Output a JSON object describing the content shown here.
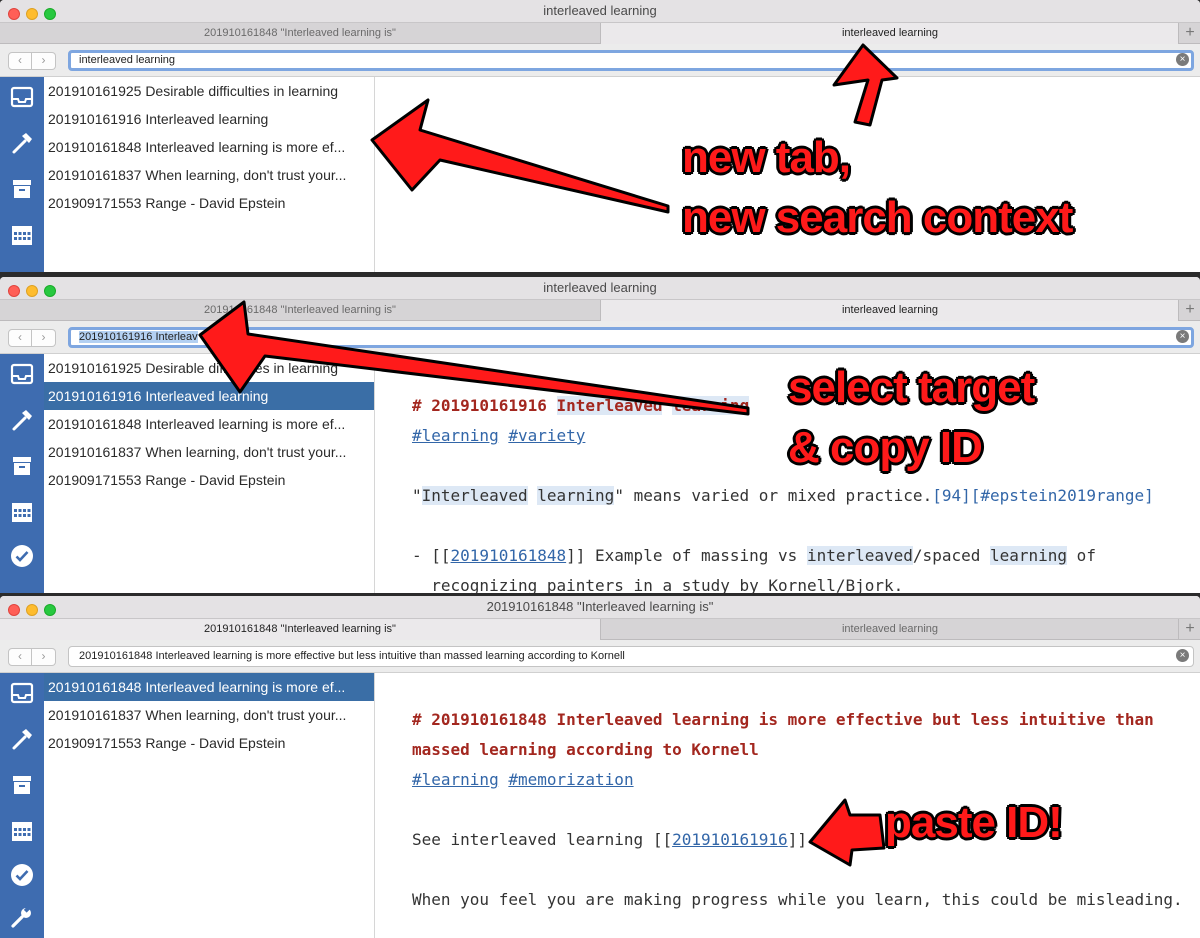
{
  "windows": [
    {
      "title": "interleaved learning",
      "tabs": [
        "201910161848 \"Interleaved learning is\"",
        "interleaved learning"
      ],
      "active_tab": 1,
      "search": "interleaved learning",
      "list": [
        "201910161925 Desirable difficulties in learning",
        "201910161916 Interleaved learning",
        "201910161848 Interleaved learning is more ef...",
        "201910161837 When learning, don't trust your...",
        "201909171553 Range - David Epstein"
      ]
    },
    {
      "title": "interleaved learning",
      "tabs": [
        "201910161848 \"Interleaved learning is\"",
        "interleaved learning"
      ],
      "active_tab": 1,
      "search_selected": "201910161916 Interleaved learning",
      "search_visible": "201910161916 Interleav",
      "list": [
        "201910161925 Desirable difficulties in learning",
        "201910161916 Interleaved learning",
        "201910161848 Interleaved learning is more ef...",
        "201910161837 When learning, don't trust your...",
        "201909171553 Range - David Epstein"
      ],
      "editor": {
        "heading_prefix": "# 201910161916 ",
        "heading_words": [
          "Interleaved",
          "learning"
        ],
        "tags": [
          "#learning",
          "#variety"
        ],
        "para_open_quote": "\"",
        "para_word1": "Interleaved",
        "para_word2": "learning",
        "para_rest": "\" means varied or mixed practice.",
        "para_cite": "[94][#epstein2019range]",
        "bullet_prefix": "- [[",
        "bullet_link": "201910161848",
        "bullet_mid": "]] Example of massing vs ",
        "bullet_hl1": "interleaved",
        "bullet_mid2": "/spaced ",
        "bullet_hl2": "learning",
        "bullet_end": " of",
        "bullet_line2": "  recognizing painters in a study by Kornell/Bjork."
      }
    },
    {
      "title": "201910161848 \"Interleaved learning is\"",
      "tabs": [
        "201910161848 \"Interleaved learning is\"",
        "interleaved learning"
      ],
      "active_tab": 0,
      "search": "201910161848 Interleaved learning is more effective but less intuitive than massed learning according to Kornell",
      "list": [
        "201910161848 Interleaved learning is more ef...",
        "201910161837 When learning, don't trust your...",
        "201909171553 Range - David Epstein"
      ],
      "editor": {
        "heading_line1": "# 201910161848 Interleaved learning is more effective but less intuitive than",
        "heading_line2": "massed learning according to Kornell",
        "tags": [
          "#learning",
          "#memorization"
        ],
        "see_prefix": "See interleaved learning [[",
        "see_link": "201910161916",
        "see_suffix": "]]",
        "last_line": "When you feel you are making progress while you learn, this could be misleading."
      }
    }
  ],
  "annotations": {
    "a1_line1": "new tab,",
    "a1_line2": "new search context",
    "a2_line1": "select target",
    "a2_line2": "& copy  ID",
    "a3": "paste ID!"
  },
  "icons": {
    "sidebar": [
      "inbox-icon",
      "hammer-icon",
      "archive-icon",
      "calendar-icon",
      "check-icon",
      "wrench-icon"
    ],
    "tab_plus": "+",
    "back": "‹",
    "forward": "›",
    "clear": "×"
  },
  "colors": {
    "sidebar": "#3e6cb0",
    "selected_row": "#3a6ea6",
    "heading": "#a3271f",
    "link": "#3266a8",
    "annotation": "#ff1a1a"
  }
}
